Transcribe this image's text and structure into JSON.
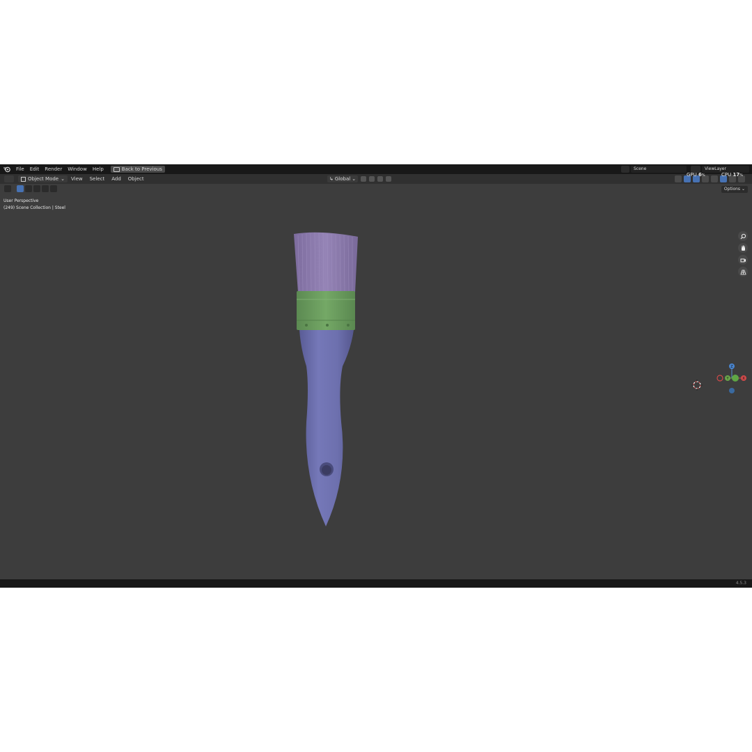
{
  "menubar": {
    "items": [
      "File",
      "Edit",
      "Render",
      "Window",
      "Help"
    ],
    "back_button": "Back to Previous",
    "scene_name": "Scene",
    "view_layer_name": "ViewLayer"
  },
  "header": {
    "mode": "Object Mode",
    "menus": [
      "View",
      "Select",
      "Add",
      "Object"
    ],
    "transform_orientation": "Global",
    "options_label": "Options"
  },
  "viewport": {
    "view_name": "User Perspective",
    "collection_info": "(249) Scene Collection | Steel"
  },
  "stats": {
    "gpu_label": "GPU",
    "gpu_value": "6",
    "gpu_unit": "%",
    "cpu_label": "CPU",
    "cpu_value": "17",
    "cpu_unit": "%"
  },
  "gizmo": {
    "z_label": "Z",
    "y_label": "Y",
    "x_label": "X"
  },
  "statusbar": {
    "version": "4.5.3"
  },
  "colors": {
    "viewport_bg": "#3d3d3d",
    "brush_bristles": "#8a7aa8",
    "brush_ferrule": "#6a9a5e",
    "brush_handle": "#6f72b0",
    "accent": "#4772b3"
  }
}
